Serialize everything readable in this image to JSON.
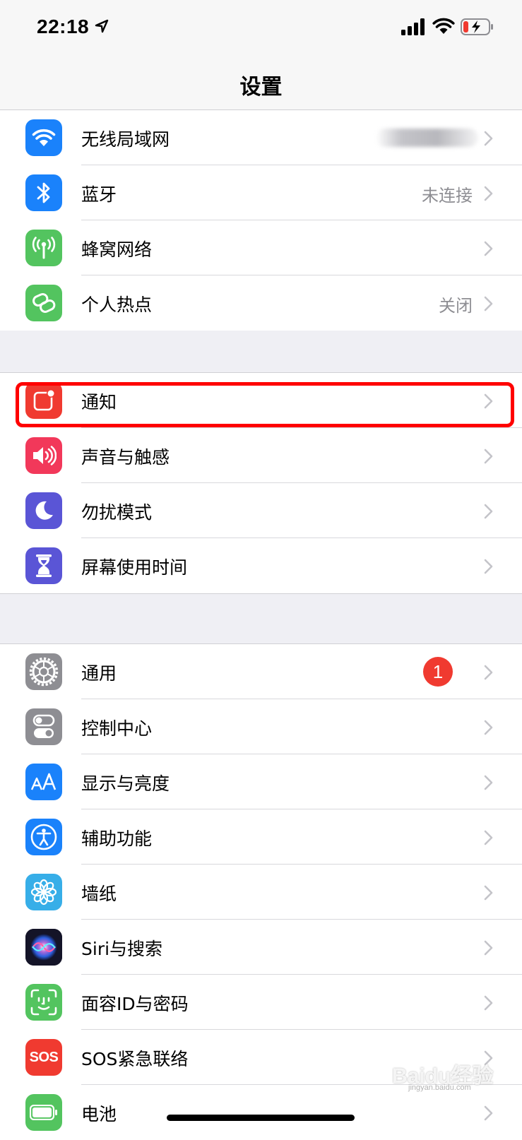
{
  "status_bar": {
    "time": "22:18"
  },
  "nav": {
    "title": "设置"
  },
  "groups": [
    {
      "items": [
        {
          "label": "无线局域网",
          "value": "",
          "icon": "wifi-icon",
          "color": "#1a82fb"
        },
        {
          "label": "蓝牙",
          "value": "未连接",
          "icon": "bluetooth-icon",
          "color": "#1a82fb"
        },
        {
          "label": "蜂窝网络",
          "value": "",
          "icon": "cellular-antenna-icon",
          "color": "#53c45f"
        },
        {
          "label": "个人热点",
          "value": "关闭",
          "icon": "hotspot-link-icon",
          "color": "#53c45f"
        }
      ]
    },
    {
      "items": [
        {
          "label": "通知",
          "value": "",
          "icon": "notifications-icon",
          "color": "#f03a30"
        },
        {
          "label": "声音与触感",
          "value": "",
          "icon": "speaker-icon",
          "color": "#f2385a"
        },
        {
          "label": "勿扰模式",
          "value": "",
          "icon": "moon-icon",
          "color": "#5a55d6"
        },
        {
          "label": "屏幕使用时间",
          "value": "",
          "icon": "hourglass-icon",
          "color": "#5a55d6"
        }
      ]
    },
    {
      "items": [
        {
          "label": "通用",
          "value": "",
          "badge": "1",
          "icon": "gear-icon",
          "color": "#8e8e93"
        },
        {
          "label": "控制中心",
          "value": "",
          "icon": "toggles-icon",
          "color": "#8e8e93"
        },
        {
          "label": "显示与亮度",
          "value": "",
          "icon": "text-size-icon",
          "color": "#1a82fb"
        },
        {
          "label": "辅助功能",
          "value": "",
          "icon": "accessibility-icon",
          "color": "#1a82fb"
        },
        {
          "label": "墙纸",
          "value": "",
          "icon": "flower-icon",
          "color": "#37aee8"
        },
        {
          "label": "Siri与搜索",
          "value": "",
          "icon": "siri-icon",
          "color": "#1c1c2e"
        },
        {
          "label": "面容ID与密码",
          "value": "",
          "icon": "face-id-icon",
          "color": "#53c45f"
        },
        {
          "label": "SOS紧急联络",
          "value": "",
          "icon": "sos-icon",
          "color": "#f03a30",
          "icon_text": "SOS"
        },
        {
          "label": "电池",
          "value": "",
          "icon": "battery-setting-icon",
          "color": "#53c45f"
        }
      ]
    }
  ],
  "watermark": {
    "text": "Baidu经验",
    "sub": "jingyan.baidu.com"
  }
}
